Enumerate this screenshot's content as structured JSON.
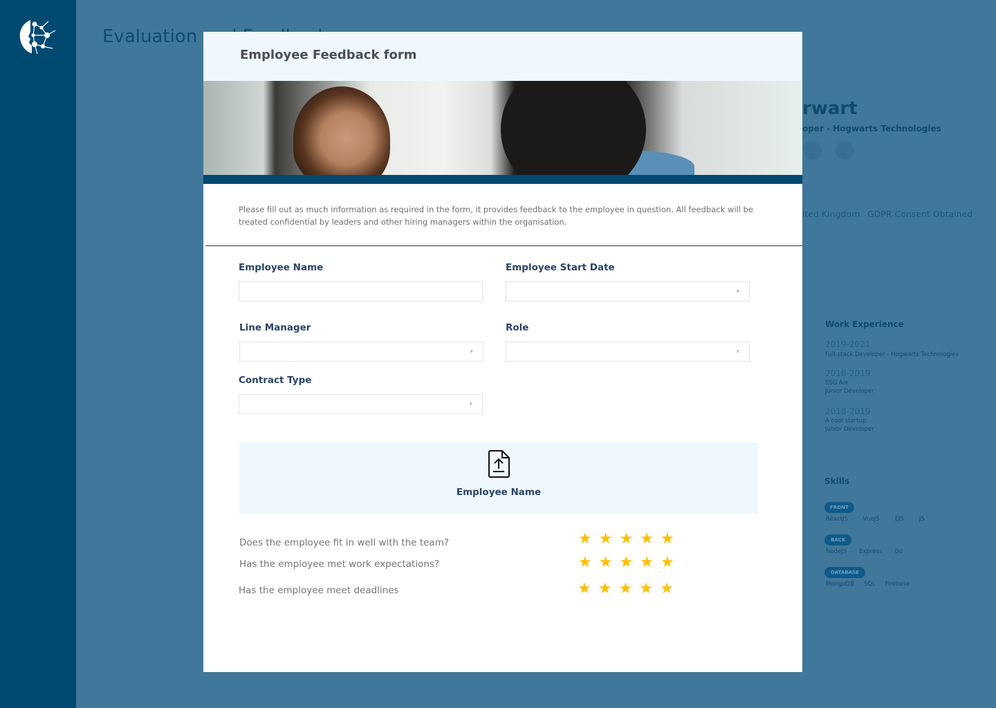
{
  "background": {
    "title": "Evaluation and Feedback",
    "profile_name": "rwart",
    "profile_subtitle": "oper - Hogwarts Technologies",
    "location": "ited Kingdom",
    "gdpr": "GDPR Consent Obtained",
    "work_title": "Work Experience",
    "work": [
      {
        "years": "2019-2021",
        "line1": "Full-stack Developer - Hogwarts Technologies",
        "line2": ""
      },
      {
        "years": "2018-2019",
        "line1": "ESG Aix",
        "line2": "Junior Developer"
      },
      {
        "years": "2018-2019",
        "line1": "A cool startup",
        "line2": "Junior Developer"
      }
    ],
    "skills_title": "Skills",
    "skills": [
      {
        "tag": "FRONT",
        "items": [
          "ReactJS",
          "VueJS",
          "EJS",
          "JS"
        ]
      },
      {
        "tag": "BACK",
        "items": [
          "NodeJS",
          "Express",
          "Go"
        ]
      },
      {
        "tag": "DATABASE",
        "items": [
          "MongoDB",
          "SQL",
          "Firebase"
        ]
      }
    ]
  },
  "modal": {
    "title": "Employee Feedback form",
    "description": "Please fill out as much information as required in the form, it provides feedback to the employee in question. All feedback will be treated confidential by leaders and other hiring managers within the organisation.",
    "fields": {
      "employee_name": {
        "label": "Employee Name",
        "value": ""
      },
      "start_date": {
        "label": "Employee Start Date",
        "value": ""
      },
      "line_manager": {
        "label": "Line Manager",
        "value": ""
      },
      "role": {
        "label": "Role",
        "value": ""
      },
      "contract_type": {
        "label": "Contract Type",
        "value": ""
      }
    },
    "dropdown_arrow": "▾",
    "upload_label": "Employee Name",
    "upload_icon": "file-upload-icon",
    "ratings": [
      {
        "question": "Does the employee fit in well with the team?",
        "stars": 5
      },
      {
        "question": "Has the employee met work expectations?",
        "stars": 5
      },
      {
        "question": "Has the employee meet deadlines",
        "stars": 5
      }
    ],
    "star_color": "#ffbf00"
  }
}
